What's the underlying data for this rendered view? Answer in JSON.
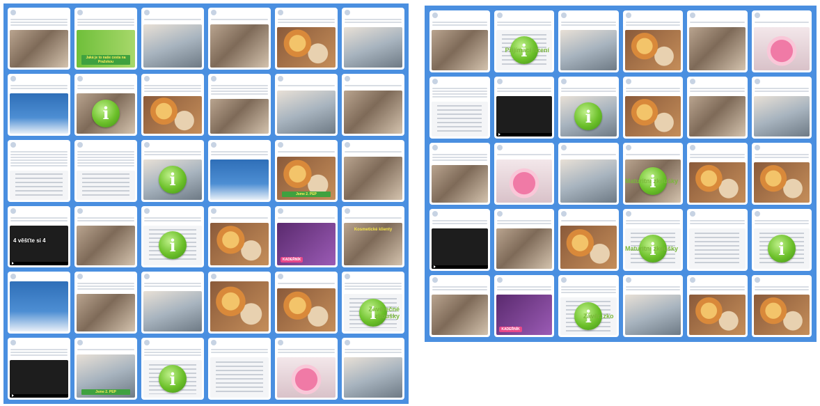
{
  "boards": [
    {
      "id": "left",
      "cards": [
        {
          "media": "m-photo",
          "lines": 3
        },
        {
          "media": "m-banner",
          "lines": 3,
          "caption": "Jaká je to naše cesta na Pražskou"
        },
        {
          "media": "m-photo2",
          "lines": 1
        },
        {
          "media": "m-photo",
          "lines": 1
        },
        {
          "media": "m-food",
          "lines": 2
        },
        {
          "media": "m-photo2",
          "lines": 2
        },
        {
          "media": "m-blue",
          "lines": 2
        },
        {
          "media": "m-photo",
          "lines": 2,
          "info": true
        },
        {
          "media": "m-food",
          "lines": 3
        },
        {
          "media": "m-photo",
          "lines": 4
        },
        {
          "media": "m-photo2",
          "lines": 1
        },
        {
          "media": "m-photo",
          "lines": 1
        },
        {
          "media": "m-doc",
          "lines": 6
        },
        {
          "media": "m-doc",
          "lines": 6
        },
        {
          "media": "m-photo2",
          "lines": 2,
          "info": true
        },
        {
          "media": "m-blue",
          "lines": 2
        },
        {
          "media": "m-food",
          "lines": 1,
          "caption": "Jsme 2. PEP"
        },
        {
          "media": "m-photo",
          "lines": 1
        },
        {
          "media": "m-video",
          "lines": 2,
          "video_text": "4 věšťte si 4"
        },
        {
          "media": "m-photo",
          "lines": 2
        },
        {
          "media": "m-doc",
          "lines": 2,
          "info": true
        },
        {
          "media": "m-food",
          "lines": 1
        },
        {
          "media": "m-purple",
          "lines": 1,
          "tag": "KADEŘNÍK"
        },
        {
          "media": "m-photo",
          "lines": 1,
          "bakery_text": "Kosmetické klienty"
        },
        {
          "media": "m-blue",
          "lines": 0
        },
        {
          "media": "m-photo",
          "lines": 3
        },
        {
          "media": "m-photo2",
          "lines": 2
        },
        {
          "media": "m-food",
          "lines": 0
        },
        {
          "media": "m-food",
          "lines": 1
        },
        {
          "media": "m-doc",
          "lines": 3,
          "info": true,
          "overlay": "Závěrečné zkoušky"
        },
        {
          "media": "m-video",
          "lines": 3
        },
        {
          "media": "m-photo2",
          "lines": 1,
          "caption": "Jsme 2. PEP"
        },
        {
          "media": "m-doc",
          "lines": 3,
          "info": true
        },
        {
          "media": "m-doc",
          "lines": 2
        },
        {
          "media": "m-cake",
          "lines": 2
        },
        {
          "media": "m-photo2",
          "lines": 2
        }
      ]
    },
    {
      "id": "right",
      "cards": [
        {
          "media": "m-photo",
          "lines": 2
        },
        {
          "media": "m-doc",
          "lines": 2,
          "info": true,
          "overlay": "Přijímací řízení"
        },
        {
          "media": "m-photo2",
          "lines": 2
        },
        {
          "media": "m-food",
          "lines": 2
        },
        {
          "media": "m-photo",
          "lines": 1
        },
        {
          "media": "m-cake",
          "lines": 1
        },
        {
          "media": "m-doc",
          "lines": 4
        },
        {
          "media": "m-video",
          "lines": 2
        },
        {
          "media": "m-photo2",
          "lines": 2,
          "info": true
        },
        {
          "media": "m-food",
          "lines": 2
        },
        {
          "media": "m-photo",
          "lines": 2
        },
        {
          "media": "m-photo2",
          "lines": 2
        },
        {
          "media": "m-photo",
          "lines": 3
        },
        {
          "media": "m-cake",
          "lines": 1
        },
        {
          "media": "m-photo2",
          "lines": 1
        },
        {
          "media": "m-photo",
          "lines": 1,
          "info": true,
          "overlay": "Maturitní zkoušky"
        },
        {
          "media": "m-food",
          "lines": 2
        },
        {
          "media": "m-food",
          "lines": 2
        },
        {
          "media": "m-video",
          "lines": 2
        },
        {
          "media": "m-photo",
          "lines": 2
        },
        {
          "media": "m-food",
          "lines": 1
        },
        {
          "media": "m-doc",
          "lines": 2,
          "info": true,
          "overlay": "Maturitní zkoušky"
        },
        {
          "media": "m-doc",
          "lines": 2
        },
        {
          "media": "m-doc",
          "lines": 2,
          "info": true
        },
        {
          "media": "m-photo",
          "lines": 2
        },
        {
          "media": "m-purple",
          "lines": 2,
          "tag": "KADEŘNÍK"
        },
        {
          "media": "m-doc",
          "lines": 3,
          "info": true,
          "overlay": "Závěr. zko"
        },
        {
          "media": "m-photo2",
          "lines": 2
        },
        {
          "media": "m-food",
          "lines": 2
        },
        {
          "media": "m-food",
          "lines": 2
        }
      ]
    }
  ]
}
